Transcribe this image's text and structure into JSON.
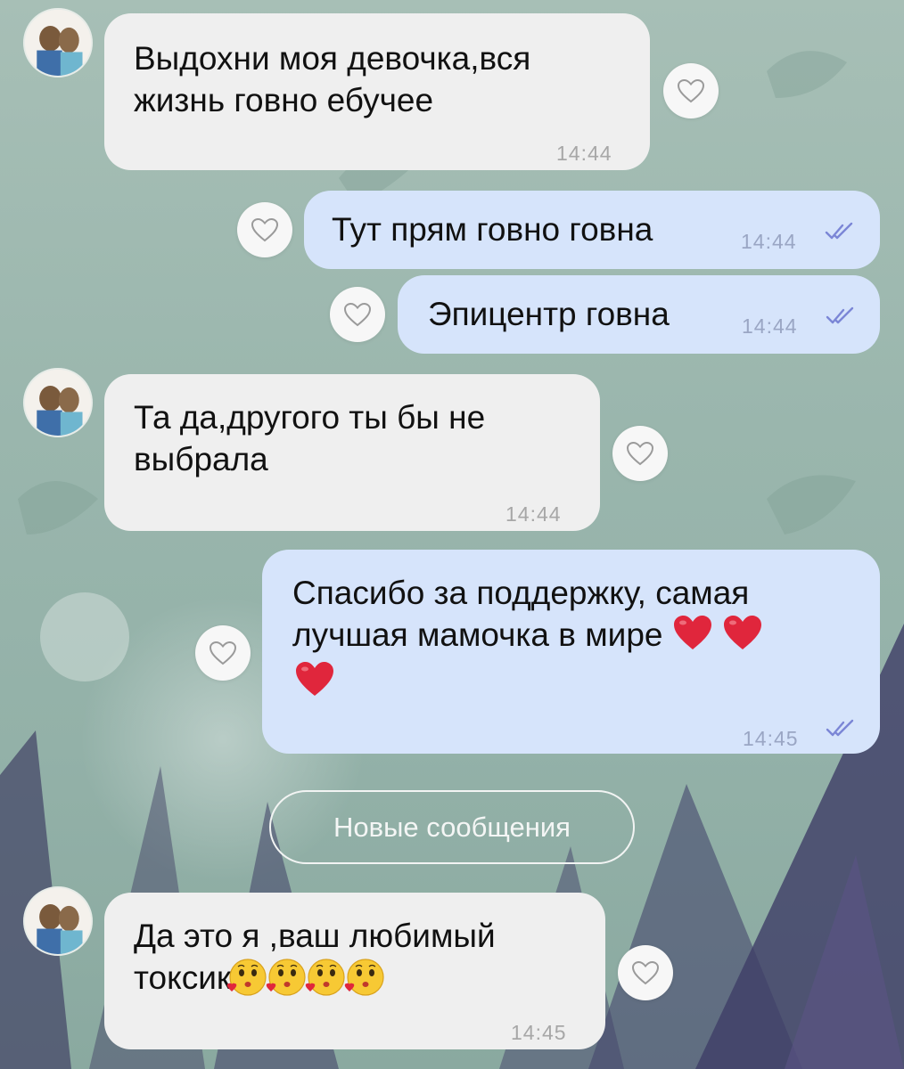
{
  "theme": {
    "incoming_bubble": "#efefef",
    "outgoing_bubble": "#d6e4fb",
    "read_ticks": "#7b86d6",
    "heart_emoji": "#e0263c"
  },
  "messages": [
    {
      "direction": "incoming",
      "lines": [
        "Выдохни моя девочка,вся",
        "жизнь говно ебучее"
      ],
      "time": "14:44"
    },
    {
      "direction": "outgoing",
      "lines": [
        "Тут прям говно говна"
      ],
      "time": "14:44",
      "status": "read"
    },
    {
      "direction": "outgoing",
      "lines": [
        "Эпицентр говна"
      ],
      "time": "14:44",
      "status": "read"
    },
    {
      "direction": "incoming",
      "lines": [
        "Та да,другого ты бы не",
        "выбрала"
      ],
      "time": "14:44"
    },
    {
      "direction": "outgoing",
      "lines": [
        "Спасибо за поддержку, самая",
        "лучшая мамочка в мире"
      ],
      "time": "14:45",
      "status": "read",
      "emoji": [
        "heart",
        "heart",
        "heart"
      ]
    },
    {
      "direction": "incoming",
      "lines": [
        "Да это я ,ваш любимый",
        "токсик"
      ],
      "time": "14:45",
      "emoji": [
        "kissing-face",
        "kissing-face",
        "kissing-face",
        "kissing-face"
      ]
    }
  ],
  "new_messages_label": "Новые сообщения"
}
